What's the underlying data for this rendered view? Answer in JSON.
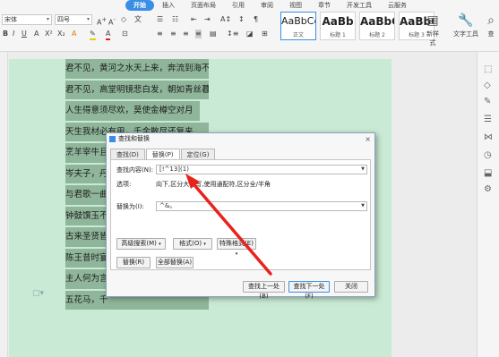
{
  "ribbon": {
    "tabs": [
      "开始",
      "插入",
      "页面布局",
      "引用",
      "审阅",
      "视图",
      "章节",
      "开发工具",
      "云服务"
    ],
    "active_tab": "开始",
    "font_name": "宋体",
    "font_size": "四号",
    "styles": [
      {
        "preview": "AaBbCcI",
        "label": "正文"
      },
      {
        "preview": "AaBb",
        "label": "标题 1"
      },
      {
        "preview": "AaBbC",
        "label": "标题 2"
      },
      {
        "preview": "AaBbC",
        "label": "标题 3"
      }
    ],
    "new_style_label": "新样式",
    "text_tool_label": "文字工具",
    "find_label": "查"
  },
  "poem": [
    "君不见，黄河之水天上来，奔流到海不复回",
    "君不见，高堂明镜悲白发，朝如青丝暮成雪",
    "人生得意须尽欢，莫使金樽空对月",
    "天生我材必有用，千金散尽还复来",
    "烹羊宰牛且",
    "岑夫子，丹",
    "与君歌一曲",
    "钟鼓馔玉不",
    "古来圣贤皆",
    "陈王昔时宴",
    "主人何为言",
    "五花马，千"
  ],
  "dialog": {
    "title": "查找和替换",
    "close": "×",
    "tabs": [
      "查找(D)",
      "替换(P)",
      "定位(G)"
    ],
    "active_tab": "替换(P)",
    "find_label": "查找内容(N):",
    "find_value": "[!^13](1)",
    "options_label": "选项:",
    "options_value": "向下,区分大小写,使用通配符,区分全/半角",
    "replace_label": "替换为(I):",
    "replace_value": "^&。",
    "advanced_btn": "高级搜索(M)",
    "format_btn": "格式(O)",
    "special_btn": "特殊格式(E)",
    "replace_btn": "替换(R)",
    "replace_all_btn": "全部替换(A)",
    "find_prev_btn": "查找上一处(B)",
    "find_next_btn": "查找下一处(F)",
    "close_btn": "关闭"
  },
  "colors": {
    "accent": "#3a8ee6",
    "page": "#c9ead4",
    "highlight": "#8fb69a",
    "arrow": "#e8231d"
  }
}
